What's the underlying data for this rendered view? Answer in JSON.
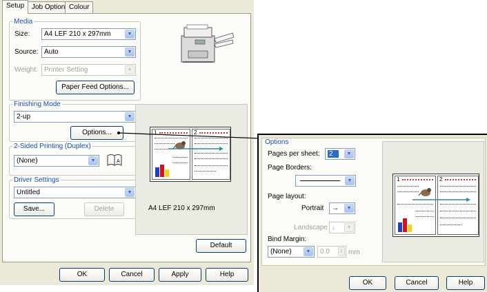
{
  "tabs": [
    "Setup",
    "Job Options",
    "Colour"
  ],
  "media": {
    "legend": "Media",
    "size_label": "Size:",
    "size_value": "A4 LEF 210 x 297mm",
    "source_label": "Source:",
    "source_value": "Auto",
    "weight_label": "Weight:",
    "weight_value": "Printer Setting",
    "paper_feed_button": "Paper Feed Options..."
  },
  "finishing": {
    "legend": "Finishing Mode",
    "value": "2-up",
    "options_button": "Options..."
  },
  "duplex": {
    "legend": "2-Sided Printing (Duplex)",
    "value": "(None)"
  },
  "driver": {
    "legend": "Driver Settings",
    "value": "Untitled",
    "save_button": "Save...",
    "delete_button": "Delete"
  },
  "preview": {
    "caption": "A4 LEF 210 x 297mm",
    "page_numbers": [
      "1",
      "2"
    ]
  },
  "buttons": {
    "default": "Default",
    "ok": "OK",
    "cancel": "Cancel",
    "apply": "Apply",
    "help": "Help"
  },
  "options_dialog": {
    "group": "Options",
    "pages_per_sheet_label": "Pages per sheet:",
    "pages_per_sheet_value": "2",
    "page_borders_label": "Page Borders:",
    "page_layout_label": "Page layout:",
    "portrait_label": "Portrait",
    "portrait_value": "→",
    "landscape_label": "Landscape",
    "landscape_value": "↓",
    "bind_margin_label": "Bind Margin:",
    "bind_margin_value": "(None)",
    "margin_amount": "0.0",
    "margin_unit": "mm",
    "ok": "OK",
    "cancel": "Cancel",
    "help": "Help"
  },
  "colors": {
    "accent": "#1a4fb6",
    "dialog_bg": "#ece9d8",
    "panel_bg": "#fbfbf8",
    "connector": "#000000"
  }
}
